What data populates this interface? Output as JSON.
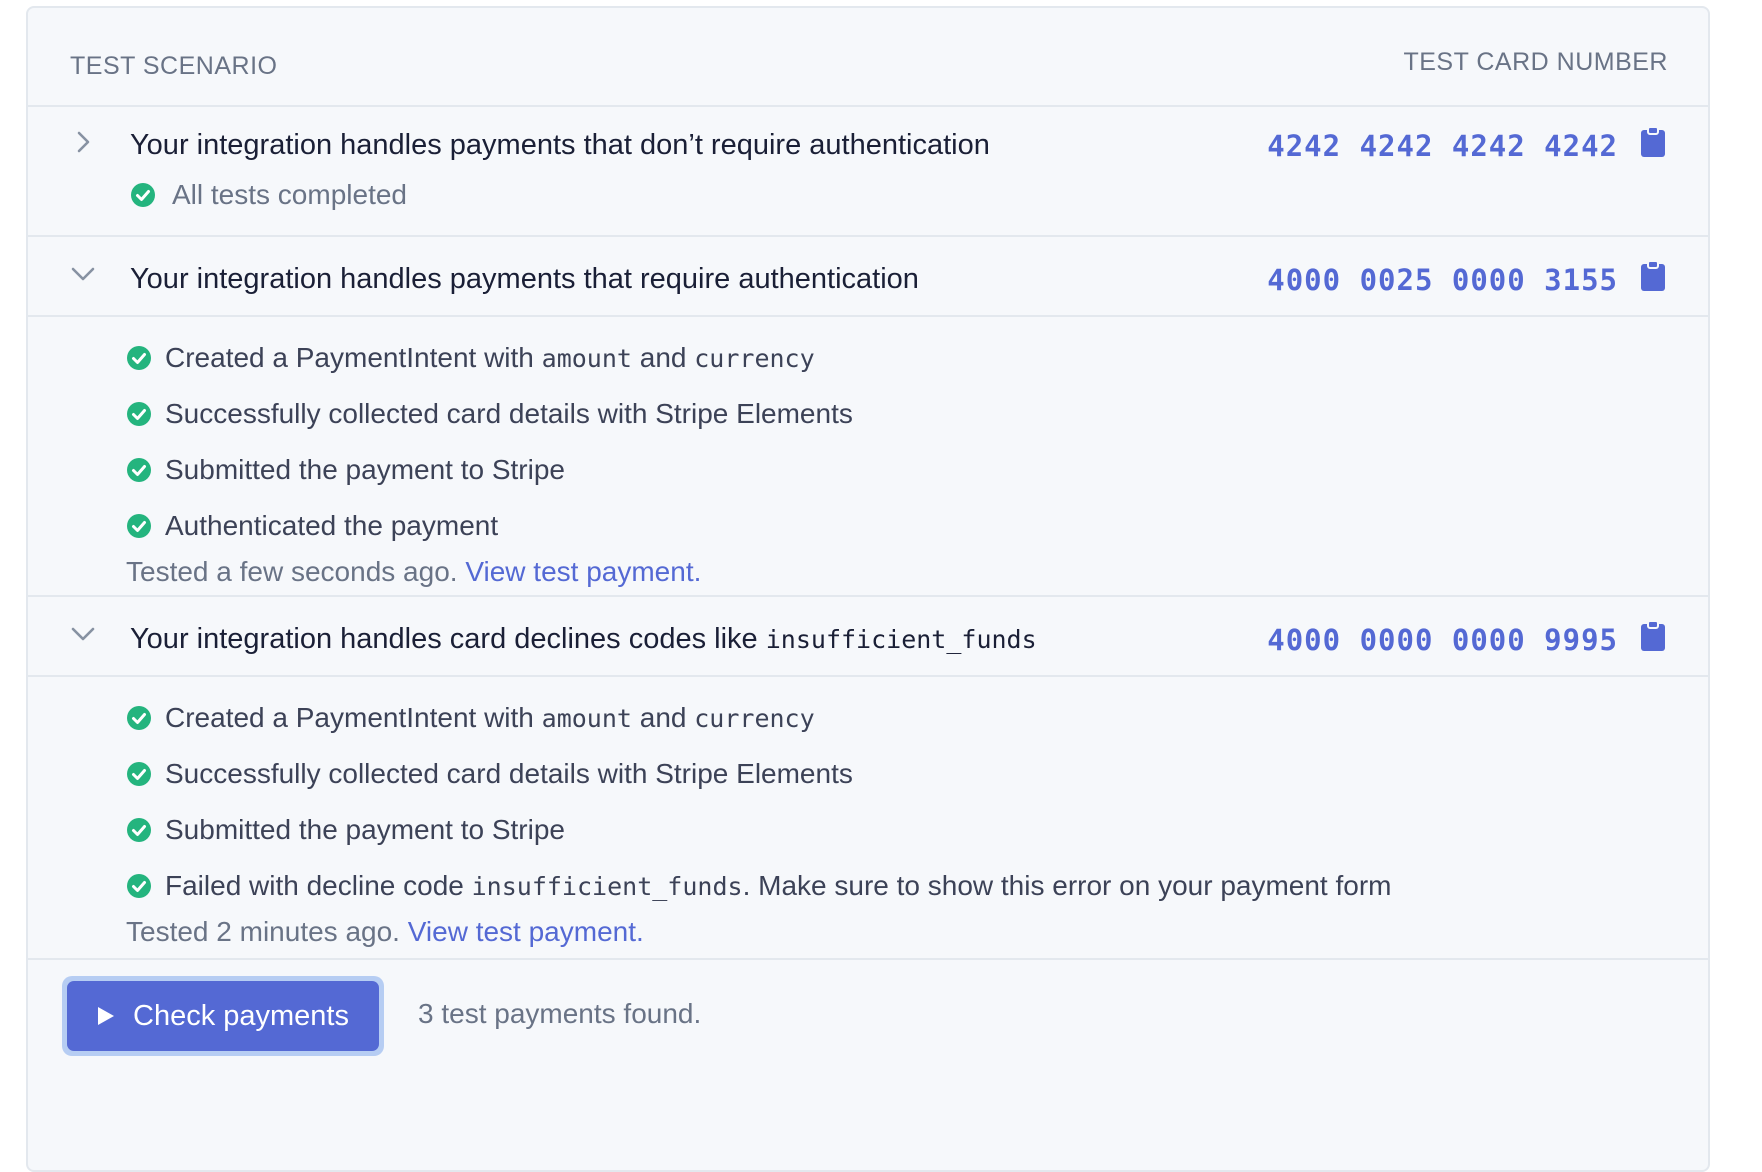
{
  "colors": {
    "accent": "#5469d4",
    "success": "#24b47e",
    "text": "#1a1f36",
    "muted": "#697386",
    "panel_bg": "#f6f8fb",
    "border": "#e3e8ee"
  },
  "header": {
    "col_scenario": "TEST SCENARIO",
    "col_card": "TEST CARD NUMBER"
  },
  "scenarios": [
    {
      "expanded": false,
      "title": "Your integration handles payments that don’t require authentication",
      "card_number": "4242 4242 4242 4242",
      "status": "All tests completed",
      "icons": {
        "toggle": "chevron-right-icon",
        "copy": "clipboard-icon",
        "status": "check-circle-icon"
      }
    },
    {
      "expanded": true,
      "title": "Your integration handles payments that require authentication",
      "card_number": "4000 0025 0000 3155",
      "steps": {
        "s1": {
          "pre": "Created a PaymentIntent with ",
          "code1": "amount",
          "mid": " and ",
          "code2": "currency"
        },
        "s2": "Successfully collected card details with Stripe Elements",
        "s3": "Submitted the payment to Stripe",
        "s4": "Authenticated the payment"
      },
      "tested_text": "Tested a few seconds ago.",
      "view_link": "View test payment.",
      "icons": {
        "toggle": "chevron-down-icon",
        "copy": "clipboard-icon",
        "step": "check-circle-icon"
      }
    },
    {
      "expanded": true,
      "title_text": "Your integration handles card declines codes like ",
      "title_code": "insufficient_funds",
      "card_number": "4000 0000 0000 9995",
      "steps": {
        "s1": {
          "pre": "Created a PaymentIntent with ",
          "code1": "amount",
          "mid": " and ",
          "code2": "currency"
        },
        "s2": "Successfully collected card details with Stripe Elements",
        "s3": "Submitted the payment to Stripe",
        "s4": {
          "pre": "Failed with decline code ",
          "code": "insufficient_funds",
          "post": ". Make sure to show this error on your payment form"
        }
      },
      "tested_text": "Tested 2 minutes ago.",
      "view_link": "View test payment.",
      "icons": {
        "toggle": "chevron-down-icon",
        "copy": "clipboard-icon",
        "step": "check-circle-icon"
      }
    }
  ],
  "footer": {
    "button_label": "Check payments",
    "button_icon": "play-icon",
    "found_text": "3 test payments found."
  }
}
